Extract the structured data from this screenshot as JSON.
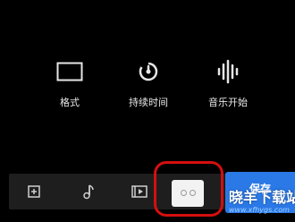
{
  "options": [
    {
      "label": "格式",
      "icon": "rectangle-format-icon"
    },
    {
      "label": "持续时间",
      "icon": "timer-icon"
    },
    {
      "label": "音乐开始",
      "icon": "audio-waveform-icon"
    }
  ],
  "bottombar": {
    "icons": [
      "add-frame-icon",
      "music-note-icon",
      "video-clip-icon"
    ]
  },
  "save_button": {
    "label": "保存"
  },
  "watermark": {
    "title": "晓羊下载站",
    "url": "www.xfhygs.com"
  },
  "colors": {
    "accent": "#2b79e6",
    "highlight": "#d40f0f",
    "background": "#000000"
  }
}
